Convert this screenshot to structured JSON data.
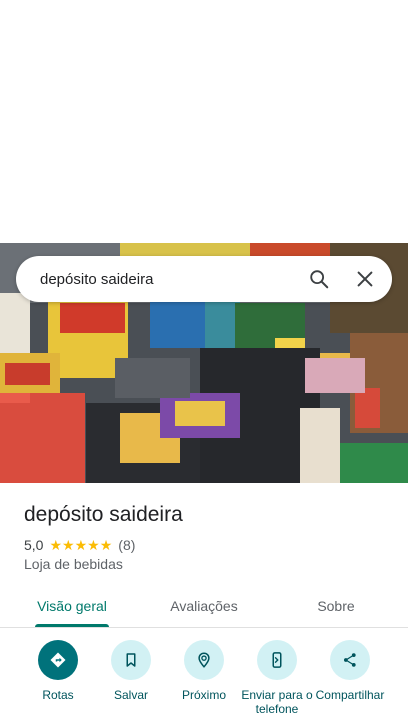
{
  "search": {
    "query": "depósito saideira",
    "search_icon": "search-icon",
    "close_icon": "close-icon"
  },
  "photo": {
    "description_icon": "place-photo"
  },
  "place": {
    "name": "depósito saideira",
    "rating": "5,0",
    "stars": 5,
    "review_count": "(8)",
    "category": "Loja de bebidas"
  },
  "tabs": [
    {
      "label": "Visão geral",
      "active": true
    },
    {
      "label": "Avaliações",
      "active": false
    },
    {
      "label": "Sobre",
      "active": false
    }
  ],
  "actions": [
    {
      "label": "Rotas",
      "icon": "directions-icon"
    },
    {
      "label": "Salvar",
      "icon": "bookmark-icon"
    },
    {
      "label": "Próximo",
      "icon": "nearby-icon"
    },
    {
      "label": "Enviar para o telefone",
      "icon": "send-to-phone-icon"
    },
    {
      "label": "Compartilhar",
      "icon": "share-icon"
    }
  ],
  "colors": {
    "accent": "#00796b",
    "action_bg": "#d2f1f4",
    "primary_action": "#00727b",
    "star": "#fbbc04"
  }
}
